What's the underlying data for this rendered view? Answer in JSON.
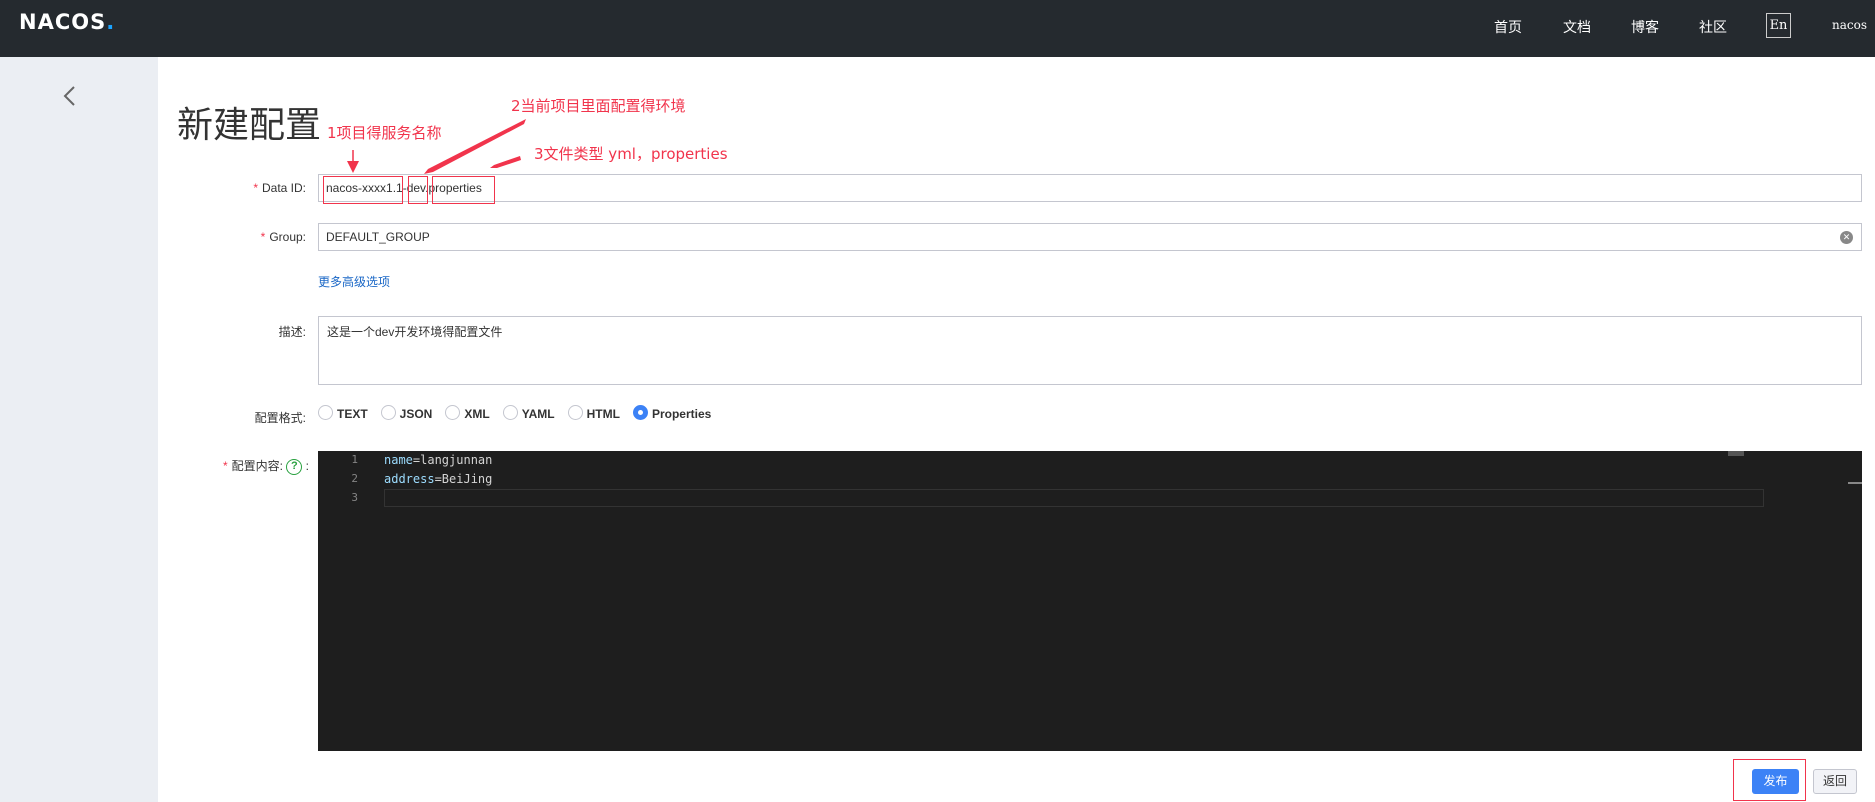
{
  "topbar": {
    "logo_main": "NACOS",
    "logo_dot": ".",
    "nav": [
      "首页",
      "文档",
      "博客",
      "社区"
    ],
    "lang": "En",
    "user": "nacos"
  },
  "page": {
    "title": "新建配置"
  },
  "form": {
    "data_id_label": "Data ID:",
    "data_id_value": "nacos-xxxx1.1-dev.properties",
    "group_label": "Group:",
    "group_value": "DEFAULT_GROUP",
    "more_options": "更多高级选项",
    "desc_label": "描述:",
    "desc_value": "这是一个dev开发环境得配置文件",
    "format_label": "配置格式:",
    "formats": [
      "TEXT",
      "JSON",
      "XML",
      "YAML",
      "HTML",
      "Properties"
    ],
    "format_selected": "Properties",
    "content_label": "配置内容:",
    "required_mark": "*",
    "help_glyph": "?",
    "colon": ":"
  },
  "editor": {
    "line_numbers": [
      "1",
      "2",
      "3"
    ],
    "lines": [
      {
        "key": "name",
        "value": "=langjunnan"
      },
      {
        "key": "address",
        "value": "=BeiJing"
      },
      {
        "key": "",
        "value": ""
      }
    ]
  },
  "buttons": {
    "publish": "发布",
    "back": "返回"
  },
  "annotations": {
    "a1": "1项目得服务名称",
    "a2": "2当前项目里面配置得环境",
    "a3": "3文件类型 yml，properties",
    "color": "#f1344c"
  }
}
